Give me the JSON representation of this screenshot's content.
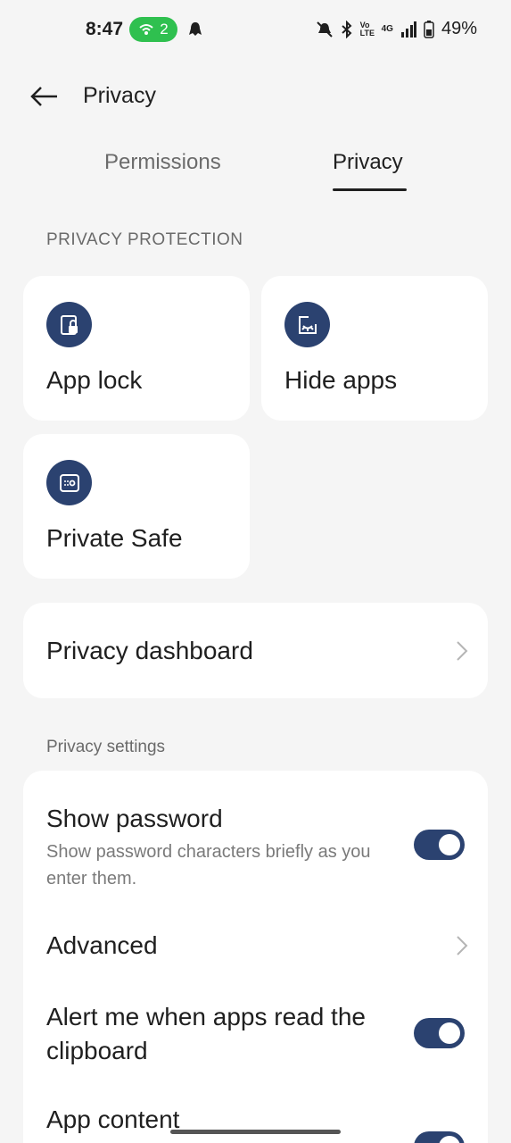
{
  "status": {
    "time": "8:47",
    "hotspot_count": "2",
    "battery": "49%",
    "network": "4G",
    "volte": "Vo LTE"
  },
  "app_bar": {
    "title": "Privacy"
  },
  "tabs": [
    {
      "label": "Permissions",
      "selected": false
    },
    {
      "label": "Privacy",
      "selected": true
    }
  ],
  "sections": {
    "protection_header": "PRIVACY PROTECTION",
    "settings_header": "Privacy settings"
  },
  "tiles": [
    {
      "label": "App lock",
      "icon": "app-lock-icon"
    },
    {
      "label": "Hide apps",
      "icon": "hide-apps-icon"
    },
    {
      "label": "Private Safe",
      "icon": "private-safe-icon"
    }
  ],
  "dashboard": {
    "label": "Privacy dashboard"
  },
  "settings": [
    {
      "title": "Show password",
      "subtitle": "Show password characters briefly as you enter them.",
      "toggle": true
    },
    {
      "title": "Advanced",
      "chevron": true
    },
    {
      "title": "Alert me when apps read the clipboard",
      "toggle": true
    },
    {
      "title": "App content",
      "toggle": true
    }
  ],
  "colors": {
    "accent": "#2b4270",
    "hotspot": "#2fc04f",
    "background": "#f5f5f5",
    "card": "#ffffff"
  }
}
